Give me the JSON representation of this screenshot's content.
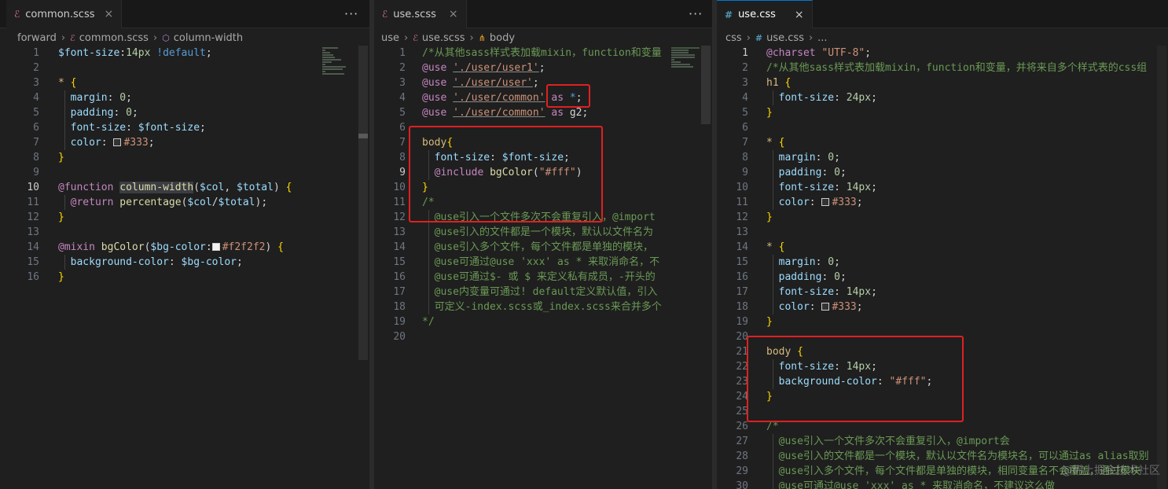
{
  "panes": [
    {
      "tab": {
        "icon": "sass-file-icon",
        "label": "common.scss",
        "close": "×"
      },
      "more": "···",
      "breadcrumb": [
        "forward",
        "common.scss",
        "column-width"
      ],
      "lines": [
        {
          "n": "1",
          "s": [
            [
              "$font-size",
              "var"
            ],
            [
              ":",
              "plain"
            ],
            [
              "14px ",
              "num"
            ],
            [
              "!default",
              "dim"
            ],
            [
              ";",
              "plain"
            ]
          ]
        },
        {
          "n": "2",
          "s": []
        },
        {
          "n": "3",
          "s": [
            [
              "* ",
              "sel"
            ],
            [
              "{",
              "br"
            ]
          ]
        },
        {
          "n": "4",
          "s": [
            [
              "  margin",
              "prop"
            ],
            [
              ": ",
              "plain"
            ],
            [
              "0",
              "num"
            ],
            [
              ";",
              "plain"
            ]
          ]
        },
        {
          "n": "5",
          "s": [
            [
              "  padding",
              "prop"
            ],
            [
              ": ",
              "plain"
            ],
            [
              "0",
              "num"
            ],
            [
              ";",
              "plain"
            ]
          ]
        },
        {
          "n": "6",
          "s": [
            [
              "  font-size",
              "prop"
            ],
            [
              ": ",
              "plain"
            ],
            [
              "$font-size",
              "var"
            ],
            [
              ";",
              "plain"
            ]
          ]
        },
        {
          "n": "7",
          "s": [
            [
              "  color",
              "prop"
            ],
            [
              ": ",
              "plain"
            ],
            [
              "#333333",
              "swatch"
            ],
            [
              "#333",
              "str"
            ],
            [
              ";",
              "plain"
            ]
          ]
        },
        {
          "n": "8",
          "s": [
            [
              "}",
              "br"
            ]
          ]
        },
        {
          "n": "9",
          "s": []
        },
        {
          "n": "10",
          "s": [
            [
              "@function ",
              "kw"
            ],
            [
              "column-width",
              "fnhl"
            ],
            [
              "(",
              "plain"
            ],
            [
              "$col",
              "var"
            ],
            [
              ", ",
              "plain"
            ],
            [
              "$total",
              "var"
            ],
            [
              ") ",
              "plain"
            ],
            [
              "{",
              "br"
            ]
          ]
        },
        {
          "n": "11",
          "s": [
            [
              "  @return ",
              "kw"
            ],
            [
              "percentage",
              "fn"
            ],
            [
              "(",
              "plain"
            ],
            [
              "$col",
              "var"
            ],
            [
              "/",
              "plain"
            ],
            [
              "$total",
              "var"
            ],
            [
              ");",
              "plain"
            ]
          ]
        },
        {
          "n": "12",
          "s": [
            [
              "}",
              "br"
            ]
          ]
        },
        {
          "n": "13",
          "s": []
        },
        {
          "n": "14",
          "s": [
            [
              "@mixin ",
              "kw"
            ],
            [
              "bgColor",
              "fn"
            ],
            [
              "(",
              "plain"
            ],
            [
              "$bg-color",
              "var"
            ],
            [
              ":",
              "plain"
            ],
            [
              "#f2f2f2",
              "swatch"
            ],
            [
              "#f2f2f2",
              "str"
            ],
            [
              ") ",
              "plain"
            ],
            [
              "{",
              "br"
            ]
          ]
        },
        {
          "n": "15",
          "s": [
            [
              "  background-color",
              "prop"
            ],
            [
              ": ",
              "plain"
            ],
            [
              "$bg-color",
              "var"
            ],
            [
              ";",
              "plain"
            ]
          ]
        },
        {
          "n": "16",
          "s": [
            [
              "}",
              "br"
            ]
          ]
        }
      ]
    },
    {
      "tab": {
        "icon": "sass-file-icon",
        "label": "use.scss",
        "close": "×"
      },
      "more": "···",
      "breadcrumb": [
        "use",
        "use.scss",
        "body"
      ],
      "lines": [
        {
          "n": "1",
          "s": [
            [
              "/*从其他sass样式表加载mixin，function和变量",
              "com"
            ]
          ]
        },
        {
          "n": "2",
          "s": [
            [
              "@use ",
              "kw"
            ],
            [
              "'./user/user1'",
              "strul"
            ],
            [
              ";",
              "plain"
            ]
          ]
        },
        {
          "n": "3",
          "s": [
            [
              "@use ",
              "kw"
            ],
            [
              "'./user/user'",
              "strul"
            ],
            [
              ";",
              "plain"
            ]
          ]
        },
        {
          "n": "4",
          "s": [
            [
              "@use ",
              "kw"
            ],
            [
              "'./user/common'",
              "strul"
            ],
            [
              " as ",
              "kw"
            ],
            [
              "*",
              "dim"
            ],
            [
              ";",
              "plain"
            ]
          ]
        },
        {
          "n": "5",
          "s": [
            [
              "@use ",
              "kw"
            ],
            [
              "'./user/common'",
              "strul"
            ],
            [
              " as ",
              "kw"
            ],
            [
              "g2",
              "plain"
            ],
            [
              ";",
              "plain"
            ]
          ]
        },
        {
          "n": "6",
          "s": []
        },
        {
          "n": "7",
          "s": [
            [
              "body",
              "sel"
            ],
            [
              "{",
              "br"
            ]
          ]
        },
        {
          "n": "8",
          "s": [
            [
              "  font-size",
              "prop"
            ],
            [
              ": ",
              "plain"
            ],
            [
              "$font-size",
              "var"
            ],
            [
              ";",
              "plain"
            ]
          ]
        },
        {
          "n": "9",
          "s": [
            [
              "  @include ",
              "kw"
            ],
            [
              "bgColor",
              "fn"
            ],
            [
              "(",
              "plain"
            ],
            [
              "\"#fff\"",
              "str"
            ],
            [
              ")",
              "plain"
            ]
          ]
        },
        {
          "n": "10",
          "s": [
            [
              "}",
              "br"
            ]
          ]
        },
        {
          "n": "11",
          "s": [
            [
              "/*",
              "com"
            ]
          ]
        },
        {
          "n": "12",
          "s": [
            [
              "  @use引入一个文件多次不会重复引入，@import",
              "com"
            ]
          ]
        },
        {
          "n": "13",
          "s": [
            [
              "  @use引入的文件都是一个模块，默认以文件名为",
              "com"
            ]
          ]
        },
        {
          "n": "14",
          "s": [
            [
              "  @use引入多个文件，每个文件都是单独的模块，",
              "com"
            ]
          ]
        },
        {
          "n": "15",
          "s": [
            [
              "  @use可通过@use 'xxx' as * 来取消命名，不",
              "com"
            ]
          ]
        },
        {
          "n": "16",
          "s": [
            [
              "  @use可通过$- 或 $ 来定义私有成员，-开头的",
              "com"
            ]
          ]
        },
        {
          "n": "17",
          "s": [
            [
              "  @use内变量可通过! default定义默认值，引入",
              "com"
            ]
          ]
        },
        {
          "n": "18",
          "s": [
            [
              "  可定义-index.scss或_index.scss来合并多个",
              "com"
            ]
          ]
        },
        {
          "n": "19",
          "s": [
            [
              "*/",
              "com"
            ]
          ]
        },
        {
          "n": "20",
          "s": []
        }
      ]
    },
    {
      "tab": {
        "icon": "css-file-icon",
        "label": "use.css",
        "close": "×"
      },
      "breadcrumb": [
        "css",
        "use.css",
        "..."
      ],
      "lines": [
        {
          "n": "1",
          "s": [
            [
              "@charset ",
              "kw"
            ],
            [
              "\"UTF-8\"",
              "str"
            ],
            [
              ";",
              "plain"
            ]
          ]
        },
        {
          "n": "2",
          "s": [
            [
              "/*从其他sass样式表加载mixin，function和变量，并将来自多个样式表的css组",
              "com"
            ]
          ]
        },
        {
          "n": "3",
          "s": [
            [
              "h1 ",
              "sel"
            ],
            [
              "{",
              "br"
            ]
          ]
        },
        {
          "n": "4",
          "s": [
            [
              "  font-size",
              "prop"
            ],
            [
              ": ",
              "plain"
            ],
            [
              "24px",
              "num"
            ],
            [
              ";",
              "plain"
            ]
          ]
        },
        {
          "n": "5",
          "s": [
            [
              "}",
              "br"
            ]
          ]
        },
        {
          "n": "6",
          "s": []
        },
        {
          "n": "7",
          "s": [
            [
              "* ",
              "sel"
            ],
            [
              "{",
              "br"
            ]
          ]
        },
        {
          "n": "8",
          "s": [
            [
              "  margin",
              "prop"
            ],
            [
              ": ",
              "plain"
            ],
            [
              "0",
              "num"
            ],
            [
              ";",
              "plain"
            ]
          ]
        },
        {
          "n": "9",
          "s": [
            [
              "  padding",
              "prop"
            ],
            [
              ": ",
              "plain"
            ],
            [
              "0",
              "num"
            ],
            [
              ";",
              "plain"
            ]
          ]
        },
        {
          "n": "10",
          "s": [
            [
              "  font-size",
              "prop"
            ],
            [
              ": ",
              "plain"
            ],
            [
              "14px",
              "num"
            ],
            [
              ";",
              "plain"
            ]
          ]
        },
        {
          "n": "11",
          "s": [
            [
              "  color",
              "prop"
            ],
            [
              ": ",
              "plain"
            ],
            [
              "#333333",
              "swatch"
            ],
            [
              "#333",
              "str"
            ],
            [
              ";",
              "plain"
            ]
          ]
        },
        {
          "n": "12",
          "s": [
            [
              "}",
              "br"
            ]
          ]
        },
        {
          "n": "13",
          "s": []
        },
        {
          "n": "14",
          "s": [
            [
              "* ",
              "sel"
            ],
            [
              "{",
              "br"
            ]
          ]
        },
        {
          "n": "15",
          "s": [
            [
              "  margin",
              "prop"
            ],
            [
              ": ",
              "plain"
            ],
            [
              "0",
              "num"
            ],
            [
              ";",
              "plain"
            ]
          ]
        },
        {
          "n": "16",
          "s": [
            [
              "  padding",
              "prop"
            ],
            [
              ": ",
              "plain"
            ],
            [
              "0",
              "num"
            ],
            [
              ";",
              "plain"
            ]
          ]
        },
        {
          "n": "17",
          "s": [
            [
              "  font-size",
              "prop"
            ],
            [
              ": ",
              "plain"
            ],
            [
              "14px",
              "num"
            ],
            [
              ";",
              "plain"
            ]
          ]
        },
        {
          "n": "18",
          "s": [
            [
              "  color",
              "prop"
            ],
            [
              ": ",
              "plain"
            ],
            [
              "#333333",
              "swatch"
            ],
            [
              "#333",
              "str"
            ],
            [
              ";",
              "plain"
            ]
          ]
        },
        {
          "n": "19",
          "s": [
            [
              "}",
              "br"
            ]
          ]
        },
        {
          "n": "20",
          "s": []
        },
        {
          "n": "21",
          "s": [
            [
              "body ",
              "sel"
            ],
            [
              "{",
              "br"
            ]
          ]
        },
        {
          "n": "22",
          "s": [
            [
              "  font-size",
              "prop"
            ],
            [
              ": ",
              "plain"
            ],
            [
              "14px",
              "num"
            ],
            [
              ";",
              "plain"
            ]
          ]
        },
        {
          "n": "23",
          "s": [
            [
              "  background-color",
              "prop"
            ],
            [
              ": ",
              "plain"
            ],
            [
              "\"#fff\"",
              "str"
            ],
            [
              ";",
              "plain"
            ]
          ]
        },
        {
          "n": "24",
          "s": [
            [
              "}",
              "br"
            ]
          ]
        },
        {
          "n": "25",
          "s": []
        },
        {
          "n": "26",
          "s": [
            [
              "/*",
              "com"
            ]
          ]
        },
        {
          "n": "27",
          "s": [
            [
              "  @use引入一个文件多次不会重复引入，@import会",
              "com"
            ]
          ]
        },
        {
          "n": "28",
          "s": [
            [
              "  @use引入的文件都是一个模块，默认以文件名为模块名，可以通过as alias取别",
              "com"
            ]
          ]
        },
        {
          "n": "29",
          "s": [
            [
              "  @use引入多个文件，每个文件都是单独的模块，相同变量名不会覆盖，通过模块",
              "com"
            ]
          ]
        },
        {
          "n": "30",
          "s": [
            [
              "  @use可通过@use 'xxx' as * 来取消命名，不建议这么做",
              "com"
            ]
          ]
        }
      ]
    }
  ],
  "colors": {
    "red_box": "#e02020",
    "active_tab_border": "#0078d4",
    "background": "#1f1f1f"
  },
  "watermark": "@稀土掘金技术社区"
}
